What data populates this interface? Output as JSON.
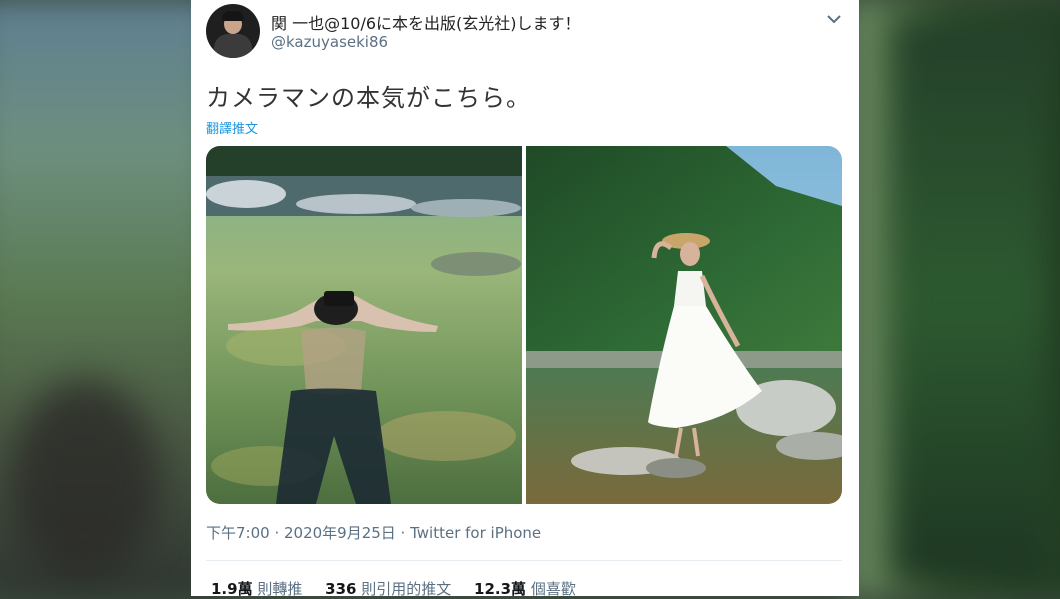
{
  "tweet": {
    "display_name": "関 一也@10/6に本を出版(玄光社)します！",
    "handle": "@kazuyaseki86",
    "text": "カメラマンの本気がこちら。",
    "translate_label": "翻譯推文",
    "timestamp": "下午7:00 · 2020年9月25日 · Twitter for iPhone",
    "stats": {
      "retweets_count": "1.9萬",
      "retweets_label": "則轉推",
      "quotes_count": "336",
      "quotes_label": "則引用的推文",
      "likes_count": "12.3萬",
      "likes_label": "個喜歡"
    },
    "icons": [
      "avatar",
      "chevron-down-icon"
    ],
    "colors": {
      "link": "#1b95e0",
      "secondary_text": "#5b7083"
    }
  }
}
